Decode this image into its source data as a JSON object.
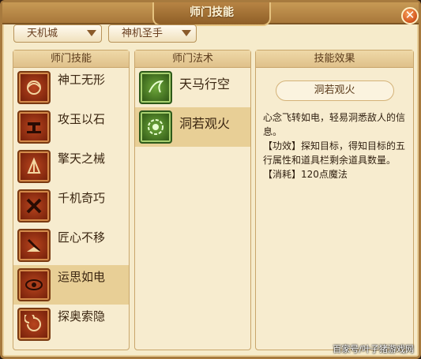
{
  "window": {
    "title": "师门技能",
    "close_label": "✕"
  },
  "filters": {
    "sect": "天机城",
    "role": "神机圣手"
  },
  "panels": {
    "skills_header": "师门技能",
    "spells_header": "师门法术",
    "effect_header": "技能效果"
  },
  "skills": [
    {
      "label": "神工无形",
      "icon": "gear-swirl-icon"
    },
    {
      "label": "攻玉以石",
      "icon": "hammer-stone-icon"
    },
    {
      "label": "擎天之械",
      "icon": "pillar-machine-icon"
    },
    {
      "label": "千机奇巧",
      "icon": "cross-blades-icon"
    },
    {
      "label": "匠心不移",
      "icon": "chisel-icon"
    },
    {
      "label": "运思如电",
      "icon": "lightning-eye-icon",
      "selected": true
    },
    {
      "label": "探奥索隐",
      "icon": "vortex-icon"
    }
  ],
  "spells": [
    {
      "label": "天马行空",
      "icon": "winged-horse-icon"
    },
    {
      "label": "洞若观火",
      "icon": "gear-flower-icon",
      "selected": true
    }
  ],
  "effect": {
    "title": "洞若观火",
    "lines": [
      "心念飞转如电，轻易洞悉敌人的信息。",
      "【功效】探知目标，得知目标的五行属性和道具栏剩余道具数量。",
      "【消耗】120点魔法"
    ]
  },
  "watermark": "百家号/叶子猪游戏网",
  "colors": {
    "selected_row": "#e8cf96",
    "panel_bg": "#f7eccf",
    "frame": "#a77a3e"
  }
}
